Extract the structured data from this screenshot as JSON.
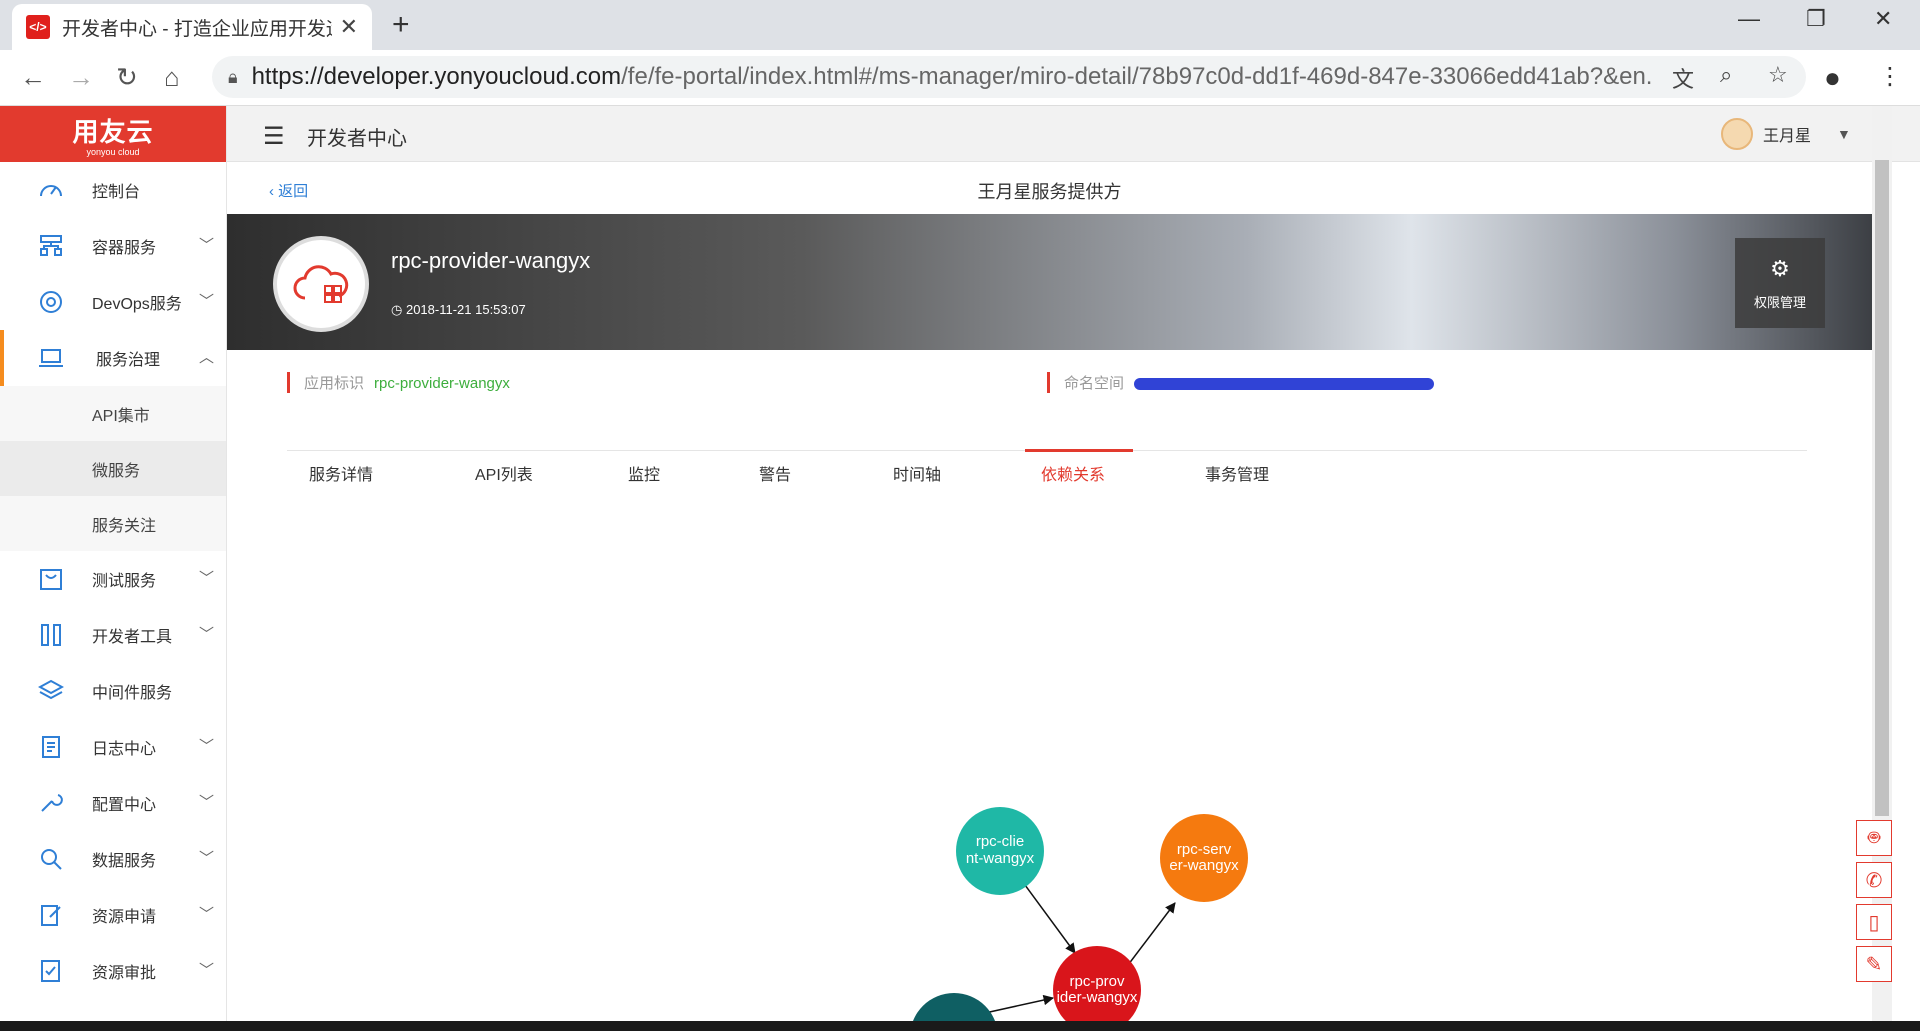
{
  "browser": {
    "tab_title": "开发者中心 - 打造企业应用开发运",
    "url_host": "https://developer.yonyoucloud.com",
    "url_path": "/fe/fe-portal/index.html#/ms-manager/miro-detail/78b97c0d-dd1f-469d-847e-33066edd41ab?&en..."
  },
  "logo": {
    "main": "用友云",
    "sub": "yonyou cloud"
  },
  "sidebar": {
    "items": [
      {
        "label": "控制台"
      },
      {
        "label": "容器服务"
      },
      {
        "label": "DevOps服务"
      },
      {
        "label": "服务治理"
      },
      {
        "label": "测试服务"
      },
      {
        "label": "开发者工具"
      },
      {
        "label": "中间件服务"
      },
      {
        "label": "日志中心"
      },
      {
        "label": "配置中心"
      },
      {
        "label": "数据服务"
      },
      {
        "label": "资源申请"
      },
      {
        "label": "资源审批"
      }
    ],
    "sub_items": [
      {
        "label": "API集市"
      },
      {
        "label": "微服务"
      },
      {
        "label": "服务关注"
      }
    ]
  },
  "header": {
    "title": "开发者中心",
    "user": "王月星"
  },
  "page": {
    "back": "返回",
    "title": "王月星服务提供方",
    "service_name": "rpc-provider-wangyx",
    "time": "2018-11-21 15:53:07",
    "perm_label": "权限管理",
    "app_id_label": "应用标识",
    "app_id_value": "rpc-provider-wangyx",
    "namespace_label": "命名空间"
  },
  "tabs": [
    "服务详情",
    "API列表",
    "监控",
    "警告",
    "时间轴",
    "依赖关系",
    "事务管理"
  ],
  "graph": {
    "nodes": [
      {
        "label1": "rpc-clie",
        "label2": "nt-wangyx",
        "color": "#1fb8a6"
      },
      {
        "label1": "rpc-serv",
        "label2": "er-wangyx",
        "color": "#f57a0f"
      },
      {
        "label1": "rpc-prov",
        "label2": "ider-wangyx",
        "color": "#d9151b"
      }
    ],
    "partial_node_color": "#0f5f63"
  },
  "colors": {
    "brand": "#e23a2e",
    "accent": "#2f7fd6",
    "active_menu": "#f58c1e"
  }
}
